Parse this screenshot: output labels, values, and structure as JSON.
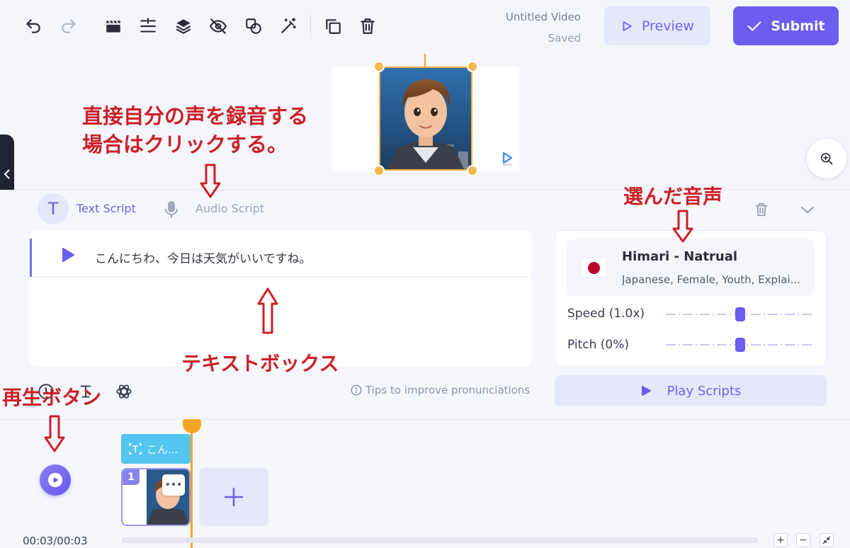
{
  "header": {
    "project_title": "Untitled Video",
    "save_status": "Saved",
    "preview_label": "Preview",
    "submit_label": "Submit"
  },
  "toolbar_icons": [
    "undo-icon",
    "redo-icon",
    "clapperboard-icon",
    "align-icon",
    "layers-icon",
    "eye-off-icon",
    "shapes-icon",
    "magic-wand-icon",
    "duplicate-icon",
    "trash-icon"
  ],
  "script": {
    "tabs": [
      {
        "label": "Text Script",
        "icon": "T",
        "active": true
      },
      {
        "label": "Audio Script",
        "icon": "microphone-icon",
        "active": false
      }
    ],
    "lines": [
      {
        "text": "こんにちわ、今日は天気がいいですね。"
      }
    ],
    "tips_label": "Tips to improve pronunciations"
  },
  "voice": {
    "name": "Himari - Natrual",
    "description": "Japanese, Female, Youth, Explai...",
    "flag": "japan-flag-icon",
    "speed_label": "Speed (1.0x)",
    "speed_value": 0.5,
    "pitch_label": "Pitch (0%)",
    "pitch_value": 0.5,
    "play_scripts_label": "Play Scripts"
  },
  "timeline": {
    "time_code": "00:03/00:03",
    "text_clip_label": "こん...",
    "scenes": [
      {
        "number": "1"
      }
    ],
    "zoom_in": "+",
    "zoom_out": "−"
  },
  "annotations": {
    "record_voice_line1": "直接自分の声を録音する",
    "record_voice_line2": "場合はクリックする。",
    "selected_voice": "選んだ音声",
    "text_box": "テキストボックス",
    "play_button": "再生ボタン"
  },
  "colors": {
    "accent": "#6c5cf0",
    "accent_light": "#e6e7fb",
    "playhead": "#f3a626",
    "clip_text": "#53c6f0",
    "annotation": "#cc1f27"
  }
}
